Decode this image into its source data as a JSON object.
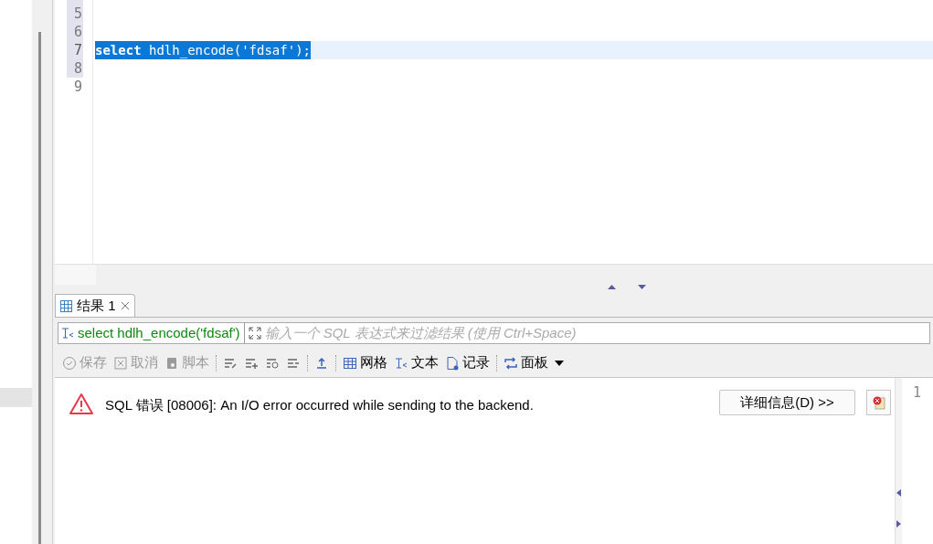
{
  "editor": {
    "lines": [
      {
        "number": "5",
        "selected": false
      },
      {
        "number": "6",
        "selected": false
      },
      {
        "number": "7",
        "code": "select hdlh_encode('fdsaf');",
        "selected": true
      },
      {
        "number": "8",
        "selected": false
      },
      {
        "number": "9",
        "selected": false
      }
    ]
  },
  "results": {
    "tabs": [
      {
        "label": "结果 1",
        "selected": true
      }
    ],
    "filter": {
      "query": "select hdlh_encode('fdsaf')",
      "placeholder": "输入一个 SQL 表达式来过滤结果 (使用 Ctrl+Space)"
    },
    "toolbar": [
      {
        "kind": "save",
        "label": "保存",
        "disabled": true
      },
      {
        "kind": "cancel",
        "label": "取消",
        "disabled": true
      },
      {
        "kind": "script",
        "label": "脚本",
        "disabled": true
      },
      {
        "kind": "sep"
      },
      {
        "kind": "edit",
        "disabled": false
      },
      {
        "kind": "add",
        "disabled": false
      },
      {
        "kind": "copy",
        "disabled": false
      },
      {
        "kind": "delete",
        "disabled": false
      },
      {
        "kind": "sep"
      },
      {
        "kind": "export",
        "disabled": false
      },
      {
        "kind": "sep"
      },
      {
        "kind": "grid",
        "label": "网格",
        "disabled": false
      },
      {
        "kind": "text",
        "label": "文本",
        "disabled": false
      },
      {
        "kind": "record",
        "label": "记录",
        "disabled": false
      },
      {
        "kind": "sep"
      },
      {
        "kind": "panels",
        "label": "面板",
        "disabled": false
      },
      {
        "kind": "menu",
        "disabled": false
      }
    ],
    "error": {
      "message": "SQL 错误 [08006]: An I/O error occurred while sending to the backend.",
      "details_button": "详细信息(D) >>"
    },
    "side_panel": {
      "line_number": "1"
    }
  }
}
